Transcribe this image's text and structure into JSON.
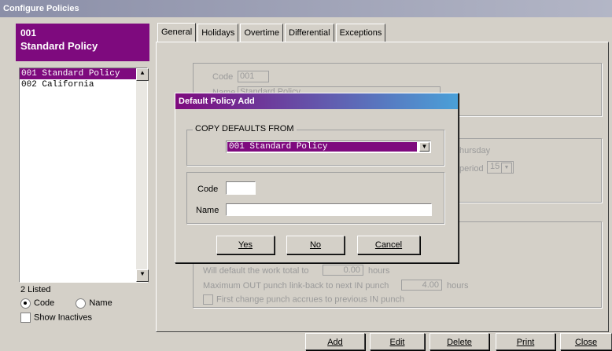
{
  "window": {
    "title": "Configure Policies"
  },
  "policy_header": {
    "code": "001",
    "name": "Standard Policy"
  },
  "policy_list": {
    "items": [
      "001 Standard Policy",
      "002 California"
    ],
    "count_text": "2 Listed",
    "sort": {
      "code_label": "Code",
      "name_label": "Name",
      "selected": "Code"
    },
    "show_inactives_label": "Show Inactives",
    "show_inactives_checked": false
  },
  "tabs": [
    "General",
    "Holidays",
    "Overtime",
    "Differential",
    "Exceptions"
  ],
  "general": {
    "code_label": "Code",
    "code_value": "001",
    "name_label": "Name",
    "name_value": "Standard Policy",
    "week_start_fragment": "hursday",
    "period_fragment": "period",
    "period_value": "15",
    "default_work_text": "Will default the work total to",
    "default_work_value": "0.00",
    "default_work_unit": "hours",
    "max_out_text": "Maximum OUT punch link-back to next IN punch",
    "max_out_value": "4.00",
    "max_out_unit": "hours",
    "first_change_text": "First change punch accrues to previous IN punch"
  },
  "dialog": {
    "title": "Default Policy Add",
    "group_label": "COPY DEFAULTS FROM",
    "combo_value": "001 Standard Policy",
    "code_label": "Code",
    "code_value": "",
    "name_label": "Name",
    "name_value": "",
    "yes": "Yes",
    "no": "No",
    "cancel": "Cancel"
  },
  "bottom_buttons": [
    "Add",
    "Edit",
    "Delete",
    "Print",
    "Close"
  ],
  "colors": {
    "accent": "#7e0a7e",
    "face": "#d4d0c8"
  }
}
